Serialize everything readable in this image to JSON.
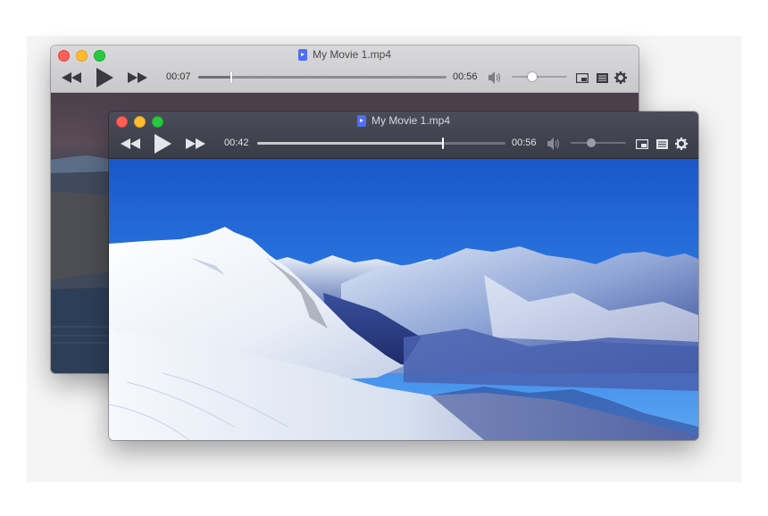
{
  "back_window": {
    "title": "My Movie 1.mp4",
    "current_time": "00:07",
    "total_time": "00:56",
    "progress": 0.13,
    "volume": 0.38
  },
  "front_window": {
    "title": "My Movie 1.mp4",
    "current_time": "00:42",
    "total_time": "00:56",
    "progress": 0.75,
    "volume": 0.38
  },
  "icons": {
    "rewind": "rewind-icon",
    "play": "play-icon",
    "fast_forward": "fast-forward-icon",
    "volume": "speaker-icon",
    "pip": "picture-in-picture-icon",
    "playlist": "playlist-icon",
    "settings": "gear-icon"
  },
  "colors": {
    "close": "#fe5f57",
    "minimize": "#febc2e",
    "maximize": "#28c840",
    "file_icon": "#4f6df5"
  }
}
